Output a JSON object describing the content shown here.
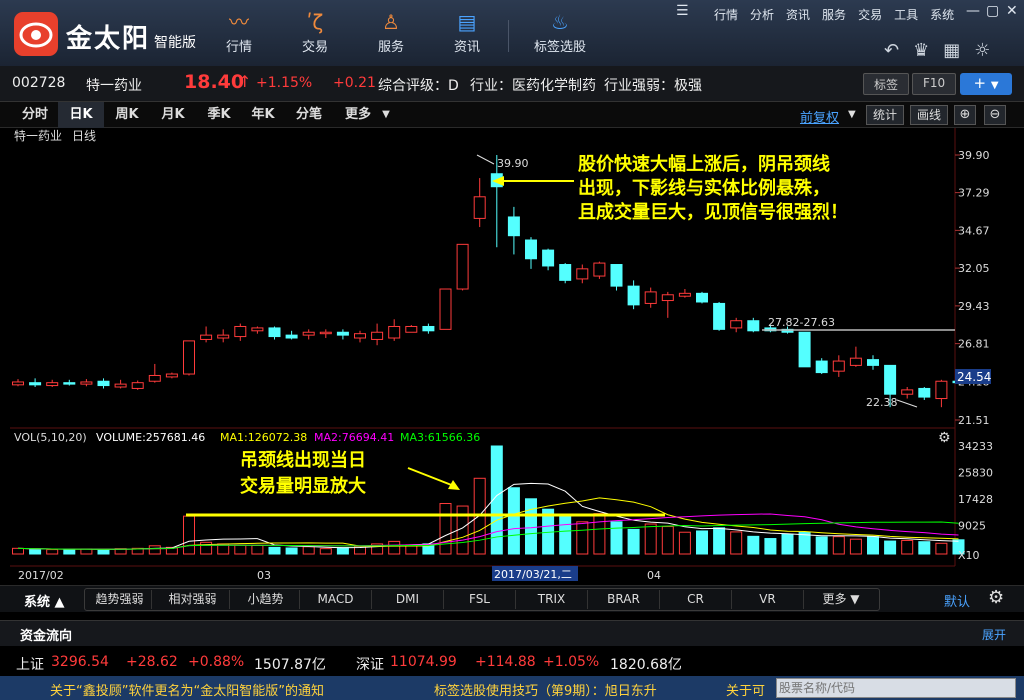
{
  "app": {
    "brand": "金太阳",
    "edition": "智能版"
  },
  "nav": [
    {
      "label": "行情",
      "icon": "trend-icon"
    },
    {
      "label": "交易",
      "icon": "trade-icon"
    },
    {
      "label": "服务",
      "icon": "person-icon"
    },
    {
      "label": "资讯",
      "icon": "news-icon"
    },
    {
      "label": "标签选股",
      "icon": "bulb-icon"
    }
  ],
  "menu": [
    "行情",
    "分析",
    "资讯",
    "服务",
    "交易",
    "工具",
    "系统"
  ],
  "stock": {
    "code": "002728",
    "name": "特一药业",
    "price": "18.40",
    "arrow": "↑",
    "pct": "+1.15%",
    "change": "+0.21",
    "rating": "综合评级：D",
    "industry": "行业：医药化学制药",
    "strength": "行业强弱：极强",
    "tag_btn": "标签",
    "f10_btn": "F10"
  },
  "tabs": [
    "分时",
    "日K",
    "周K",
    "月K",
    "季K",
    "年K",
    "分笔",
    "更多"
  ],
  "right_controls": {
    "fq": "前复权",
    "stats": "统计",
    "draw": "画线"
  },
  "chart_header": {
    "name": "特一药业",
    "period": "日线"
  },
  "vol_header": {
    "vol": "VOL(5,10,20)",
    "volume": "VOLUME:257681.46",
    "ma1": "MA1:126072.38",
    "ma2": "MA2:76694.41",
    "ma3": "MA3:61566.36"
  },
  "annotations": {
    "top_lines": [
      "股价快速大幅上涨后，阴吊颈线",
      "出现，下影线与实体比例悬殊，",
      "且成交量巨大，见顶信号很强烈！"
    ],
    "bottom_lines": [
      "吊颈线出现当日",
      "交易量明显放大"
    ],
    "high_label": "39.90",
    "low_label": "22.38",
    "range_label": "27.82-27.63"
  },
  "axis": {
    "price_ticks": [
      "39.90",
      "37.29",
      "34.67",
      "32.05",
      "29.43",
      "26.81",
      "24.18",
      "21.51"
    ],
    "current_price": "24.54",
    "vol_ticks": [
      "34233",
      "25830",
      "17428",
      "9025"
    ],
    "vol_unit": "X10",
    "dates": [
      "2017/02",
      "03",
      "2017/03/21,二",
      "04"
    ]
  },
  "indicators": {
    "system": "系统 ▲",
    "items": [
      "趋势强弱",
      "相对强弱",
      "小趋势",
      "MACD",
      "DMI",
      "FSL",
      "TRIX",
      "BRAR",
      "CR",
      "VR",
      "更多 ▼"
    ],
    "default": "默认"
  },
  "fund_flow": {
    "title": "资金流向",
    "expand": "展开"
  },
  "indices": [
    {
      "name": "上证",
      "value": "3296.54",
      "change": "+28.62",
      "pct": "+0.88%",
      "amount": "1507.87亿"
    },
    {
      "name": "深证",
      "value": "11074.99",
      "change": "+114.88",
      "pct": "+1.05%",
      "amount": "1820.68亿"
    }
  ],
  "ticker": {
    "msg1": "关于“鑫投顾”软件更名为“金太阳智能版”的通知",
    "msg2": "标签选股使用技巧（第9期）：旭日东升",
    "msg3": "关于可",
    "search_placeholder": "股票名称/代码"
  },
  "colors": {
    "up": "#ff3b3b",
    "down": "#54ffff",
    "ma5": "#ffffff",
    "ma10": "#ffff00",
    "ma20": "#ff00ff",
    "ma30": "#00ff00",
    "annotation": "#ffff00"
  },
  "chart_data": {
    "type": "candlestick",
    "title": "特一药业 日线",
    "ylim": [
      21.51,
      39.9
    ],
    "candles": [
      {
        "o": 23.95,
        "c": 24.15,
        "h": 24.35,
        "l": 23.85
      },
      {
        "o": 24.1,
        "c": 23.95,
        "h": 24.4,
        "l": 23.8
      },
      {
        "o": 23.9,
        "c": 24.1,
        "h": 24.3,
        "l": 23.8
      },
      {
        "o": 24.1,
        "c": 24.0,
        "h": 24.3,
        "l": 23.9
      },
      {
        "o": 24.0,
        "c": 24.15,
        "h": 24.35,
        "l": 23.85
      },
      {
        "o": 24.2,
        "c": 23.9,
        "h": 24.4,
        "l": 23.7
      },
      {
        "o": 23.8,
        "c": 24.0,
        "h": 24.3,
        "l": 23.7
      },
      {
        "o": 23.7,
        "c": 24.1,
        "h": 24.25,
        "l": 23.6
      },
      {
        "o": 24.2,
        "c": 24.6,
        "h": 25.4,
        "l": 24.1
      },
      {
        "o": 24.5,
        "c": 24.7,
        "h": 24.8,
        "l": 24.4
      },
      {
        "o": 24.7,
        "c": 27.0,
        "h": 27.0,
        "l": 24.6
      },
      {
        "o": 27.1,
        "c": 27.4,
        "h": 28.0,
        "l": 26.9
      },
      {
        "o": 27.2,
        "c": 27.4,
        "h": 27.8,
        "l": 26.9
      },
      {
        "o": 27.3,
        "c": 28.0,
        "h": 28.2,
        "l": 27.0
      },
      {
        "o": 27.7,
        "c": 27.9,
        "h": 28.0,
        "l": 27.5
      },
      {
        "o": 27.9,
        "c": 27.3,
        "h": 28.0,
        "l": 27.1
      },
      {
        "o": 27.4,
        "c": 27.2,
        "h": 27.7,
        "l": 27.1
      },
      {
        "o": 27.4,
        "c": 27.6,
        "h": 27.8,
        "l": 27.1
      },
      {
        "o": 27.5,
        "c": 27.6,
        "h": 27.8,
        "l": 27.2
      },
      {
        "o": 27.6,
        "c": 27.4,
        "h": 27.8,
        "l": 27.1
      },
      {
        "o": 27.2,
        "c": 27.5,
        "h": 27.7,
        "l": 26.9
      },
      {
        "o": 27.1,
        "c": 27.6,
        "h": 28.2,
        "l": 26.7
      },
      {
        "o": 27.2,
        "c": 28.0,
        "h": 28.5,
        "l": 27.0
      },
      {
        "o": 27.6,
        "c": 28.0,
        "h": 28.1,
        "l": 27.6
      },
      {
        "o": 28.0,
        "c": 27.7,
        "h": 28.2,
        "l": 27.5
      },
      {
        "o": 27.8,
        "c": 30.6,
        "h": 30.6,
        "l": 27.8
      },
      {
        "o": 30.6,
        "c": 33.7,
        "h": 33.7,
        "l": 30.5
      },
      {
        "o": 35.5,
        "c": 37.0,
        "h": 38.3,
        "l": 34.9
      },
      {
        "o": 38.6,
        "c": 37.7,
        "h": 39.9,
        "l": 33.5
      },
      {
        "o": 35.6,
        "c": 34.3,
        "h": 36.3,
        "l": 33.0
      },
      {
        "o": 34.0,
        "c": 32.7,
        "h": 34.2,
        "l": 32.0
      },
      {
        "o": 33.3,
        "c": 32.2,
        "h": 33.4,
        "l": 31.9
      },
      {
        "o": 32.3,
        "c": 31.2,
        "h": 32.4,
        "l": 31.0
      },
      {
        "o": 31.3,
        "c": 32.0,
        "h": 32.3,
        "l": 31.0
      },
      {
        "o": 31.5,
        "c": 32.4,
        "h": 32.5,
        "l": 31.3
      },
      {
        "o": 32.3,
        "c": 30.8,
        "h": 32.3,
        "l": 30.5
      },
      {
        "o": 30.8,
        "c": 29.5,
        "h": 31.2,
        "l": 29.2
      },
      {
        "o": 29.6,
        "c": 30.4,
        "h": 30.7,
        "l": 29.3
      },
      {
        "o": 29.8,
        "c": 30.2,
        "h": 30.4,
        "l": 28.6
      },
      {
        "o": 30.1,
        "c": 30.3,
        "h": 30.6,
        "l": 30.0
      },
      {
        "o": 30.3,
        "c": 29.7,
        "h": 30.4,
        "l": 29.6
      },
      {
        "o": 29.6,
        "c": 27.8,
        "h": 29.7,
        "l": 27.7
      },
      {
        "o": 27.9,
        "c": 28.4,
        "h": 28.6,
        "l": 27.6
      },
      {
        "o": 28.4,
        "c": 27.7,
        "h": 28.6,
        "l": 27.6
      },
      {
        "o": 27.9,
        "c": 27.7,
        "h": 28.1,
        "l": 27.6
      },
      {
        "o": 27.8,
        "c": 27.6,
        "h": 28.0,
        "l": 27.5
      },
      {
        "o": 27.6,
        "c": 25.2,
        "h": 27.6,
        "l": 25.2
      },
      {
        "o": 25.6,
        "c": 24.8,
        "h": 25.8,
        "l": 24.7
      },
      {
        "o": 24.9,
        "c": 25.6,
        "h": 26.0,
        "l": 24.5
      },
      {
        "o": 25.3,
        "c": 25.8,
        "h": 26.6,
        "l": 25.2
      },
      {
        "o": 25.7,
        "c": 25.3,
        "h": 26.0,
        "l": 25.0
      },
      {
        "o": 25.3,
        "c": 23.3,
        "h": 25.3,
        "l": 22.4
      },
      {
        "o": 23.3,
        "c": 23.6,
        "h": 23.8,
        "l": 23.0
      },
      {
        "o": 23.7,
        "c": 23.1,
        "h": 23.8,
        "l": 22.9
      },
      {
        "o": 23.0,
        "c": 24.2,
        "h": 24.3,
        "l": 22.4
      },
      {
        "o": 24.2,
        "c": 24.1,
        "h": 24.4,
        "l": 24.0
      }
    ],
    "volume": [
      1800,
      1500,
      1400,
      1500,
      1600,
      1300,
      1700,
      1800,
      2600,
      2100,
      12000,
      3700,
      3200,
      2800,
      2700,
      2100,
      1900,
      2300,
      1700,
      2000,
      2400,
      3200,
      4000,
      2900,
      3200,
      16000,
      15200,
      24000,
      34233,
      21000,
      17500,
      14200,
      12600,
      10200,
      12800,
      10200,
      7800,
      9500,
      8700,
      6900,
      7300,
      8300,
      7000,
      5600,
      4900,
      6300,
      6800,
      5400,
      5500,
      4700,
      5500,
      4100,
      4300,
      3900,
      3400,
      4500
    ]
  }
}
